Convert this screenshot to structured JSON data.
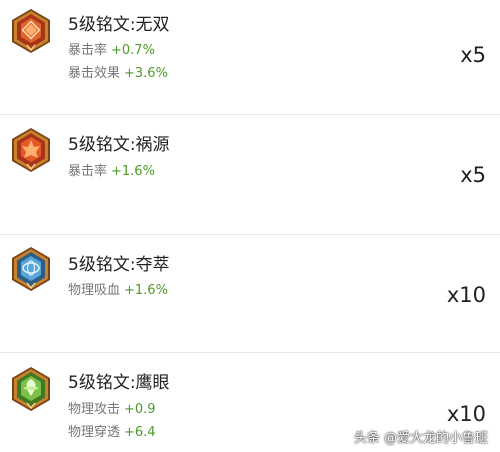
{
  "runes": [
    {
      "title": "5级铭文:无双",
      "icon": "rune-red-icon",
      "stats": [
        {
          "name": "暴击率",
          "value": "+0.7%"
        },
        {
          "name": "暴击效果",
          "value": "+3.6%"
        }
      ],
      "quantity": "x5"
    },
    {
      "title": "5级铭文:祸源",
      "icon": "rune-red-icon",
      "stats": [
        {
          "name": "暴击率",
          "value": "+1.6%"
        }
      ],
      "quantity": "x5"
    },
    {
      "title": "5级铭文:夺萃",
      "icon": "rune-blue-icon",
      "stats": [
        {
          "name": "物理吸血",
          "value": "+1.6%"
        }
      ],
      "quantity": "x10"
    },
    {
      "title": "5级铭文:鹰眼",
      "icon": "rune-green-icon",
      "stats": [
        {
          "name": "物理攻击",
          "value": "+0.9"
        },
        {
          "name": "物理穿透",
          "value": "+6.4"
        }
      ],
      "quantity": "x10"
    }
  ],
  "watermark": "头条 @爱大龙的小鲁班",
  "colors": {
    "stat_value": "#4e9a2a",
    "stat_name": "#777777",
    "title": "#222222",
    "rune_red": "#d0502a",
    "rune_blue": "#5aa6d8",
    "rune_green": "#7cc04a",
    "rune_frame": "#b8762a"
  }
}
